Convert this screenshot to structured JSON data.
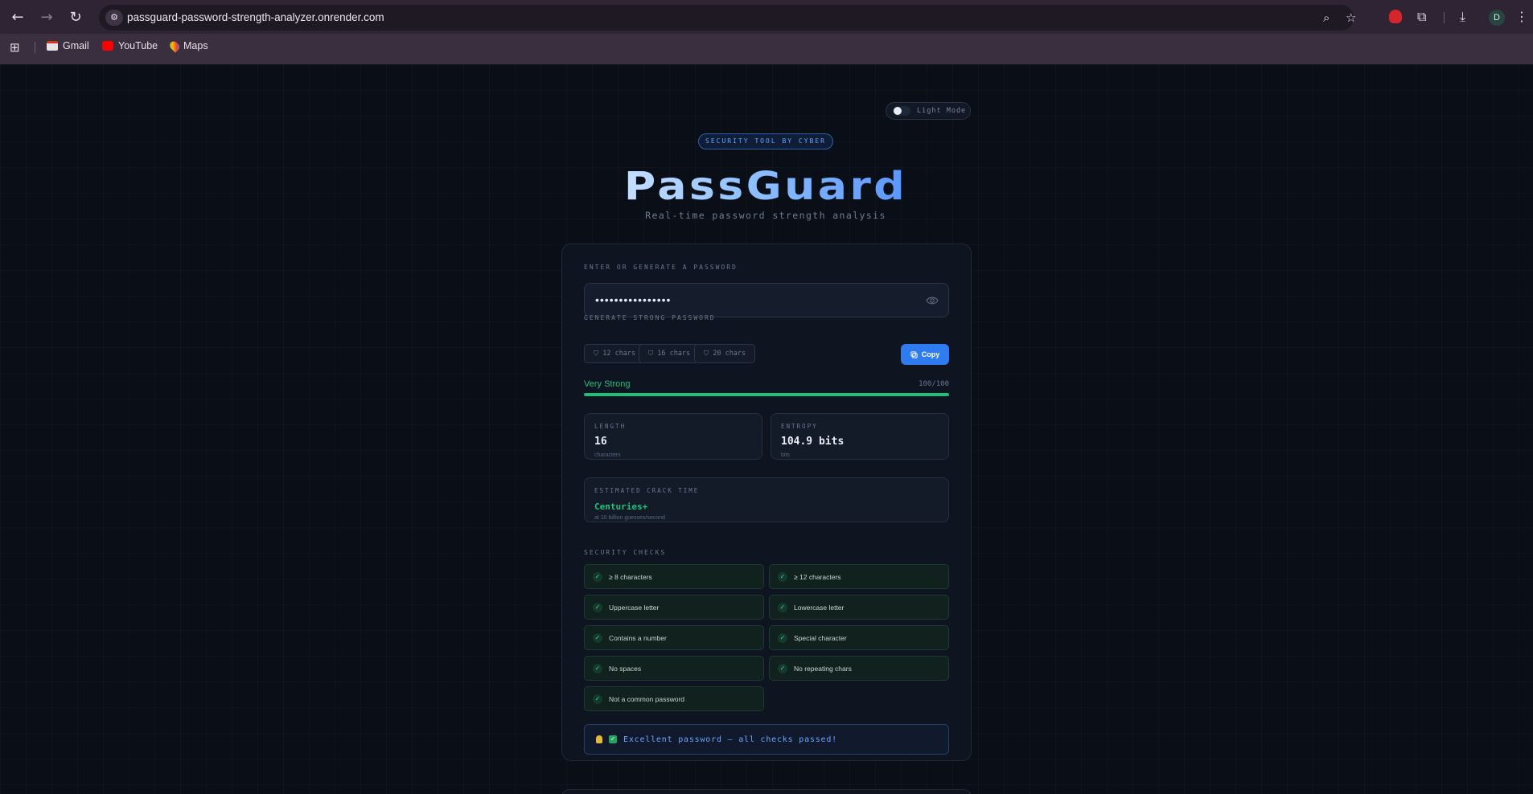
{
  "browser": {
    "url": "passguard-password-strength-analyzer.onrender.com",
    "avatar_initial": "D",
    "bookmarks": [
      {
        "label": "Gmail"
      },
      {
        "label": "YouTube"
      },
      {
        "label": "Maps"
      }
    ]
  },
  "page": {
    "mode_toggle_label": "Light Mode",
    "badge": "SECURITY TOOL BY CYBER",
    "title": "PassGuard",
    "subtitle": "Real-time password strength analysis",
    "input_label": "ENTER OR GENERATE A PASSWORD",
    "password_masked": "••••••••••••••••",
    "generate_label": "GENERATE STRONG PASSWORD",
    "generate_options": [
      "12 chars",
      "16 chars",
      "20 chars"
    ],
    "copy_label": "Copy",
    "strength_label": "Very Strong",
    "score_text": "100/100",
    "score_fraction": 1.0,
    "stats": {
      "length_title": "LENGTH",
      "length_value": "16",
      "length_unit": "characters",
      "entropy_title": "ENTROPY",
      "entropy_value": "104.9 bits",
      "entropy_unit": "bits"
    },
    "crack": {
      "title": "ESTIMATED CRACK TIME",
      "value": "Centuries+",
      "note": "at 10 billion guesses/second"
    },
    "checks_label": "SECURITY CHECKS",
    "checks": [
      "≥ 8 characters",
      "≥ 12 characters",
      "Uppercase letter",
      "Lowercase letter",
      "Contains a number",
      "Special character",
      "No spaces",
      "No repeating chars",
      "Not a common password"
    ],
    "summary": "Excellent password — all checks passed!"
  },
  "colors": {
    "accent": "#2f7bf0",
    "success": "#20c17a",
    "background": "#0a0e16"
  }
}
